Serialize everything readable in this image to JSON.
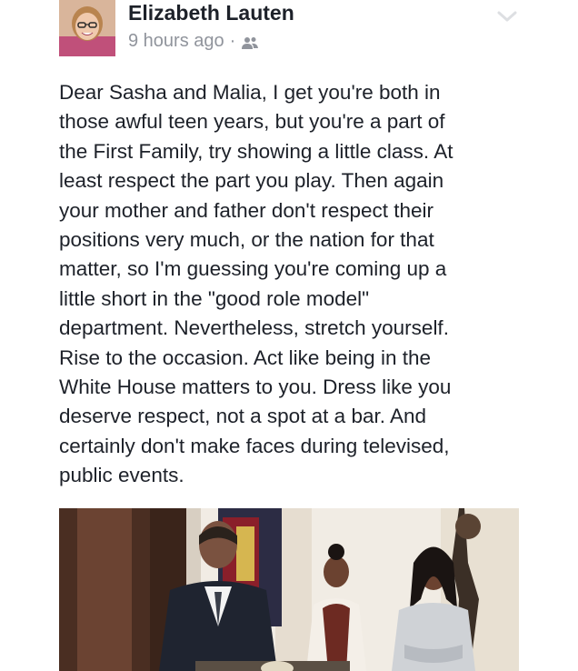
{
  "post": {
    "author": "Elizabeth Lauten",
    "timestamp": "9 hours ago",
    "separator": "·",
    "audience_icon": "friends-icon",
    "menu_icon": "chevron-down-icon",
    "text": "Dear Sasha and Malia, I get you're  both in\nthose awful teen years, but you're a part of\nthe First Family, try showing a little class. At\nleast respect the part you play. Then again\nyour mother and father don't respect their\npositions very much, or the nation for that\nmatter, so I'm guessing you're coming up a\nlittle short in the \"good role model\"\ndepartment. Nevertheless, stretch yourself.\nRise to the occasion. Act like being in the\nWhite House matters to you. Dress like you\ndeserve respect, not a spot at a bar. And\ncertainly don't make faces during televised,\npublic events."
  },
  "colors": {
    "name": "#1d2129",
    "meta": "#90949c",
    "body": "#1d2129"
  }
}
